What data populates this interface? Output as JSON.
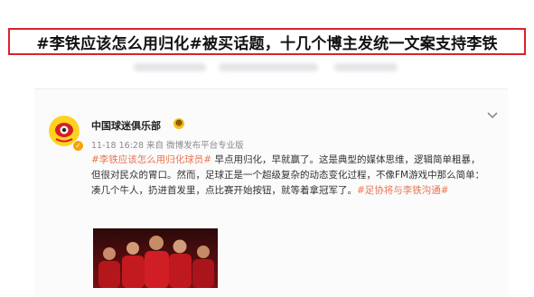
{
  "headline": "#李铁应该怎么用归化#被买话题，十几个博主发统一文案支持李铁",
  "post": {
    "author": "中国球迷俱乐部",
    "time": "11-18 16:28",
    "source_prefix": "来自",
    "source": "微博发布平台专业版",
    "hashtag_1": "#李铁应该怎么用归化球员#",
    "text_1": " 早点用归化，早就赢了。这是典型的媒体思维，逻辑简单粗暴，但很对民众的胃口。然而，足球正是一个超级复杂的动态变化过程，不像FM游戏中那么简单：凑几个牛人，扔进首发里，点比赛开始按钮，就等着拿冠军了。",
    "hashtag_2": "#足协将与李铁沟通#"
  },
  "colors": {
    "highlight_border": "#d8232a",
    "hashtag": "#eb7350",
    "photo_red": "#b3171c"
  },
  "icons": [
    "avatar-eye-logo",
    "verified-badge-icon",
    "vip-badge-icon",
    "chevron-down-icon"
  ]
}
